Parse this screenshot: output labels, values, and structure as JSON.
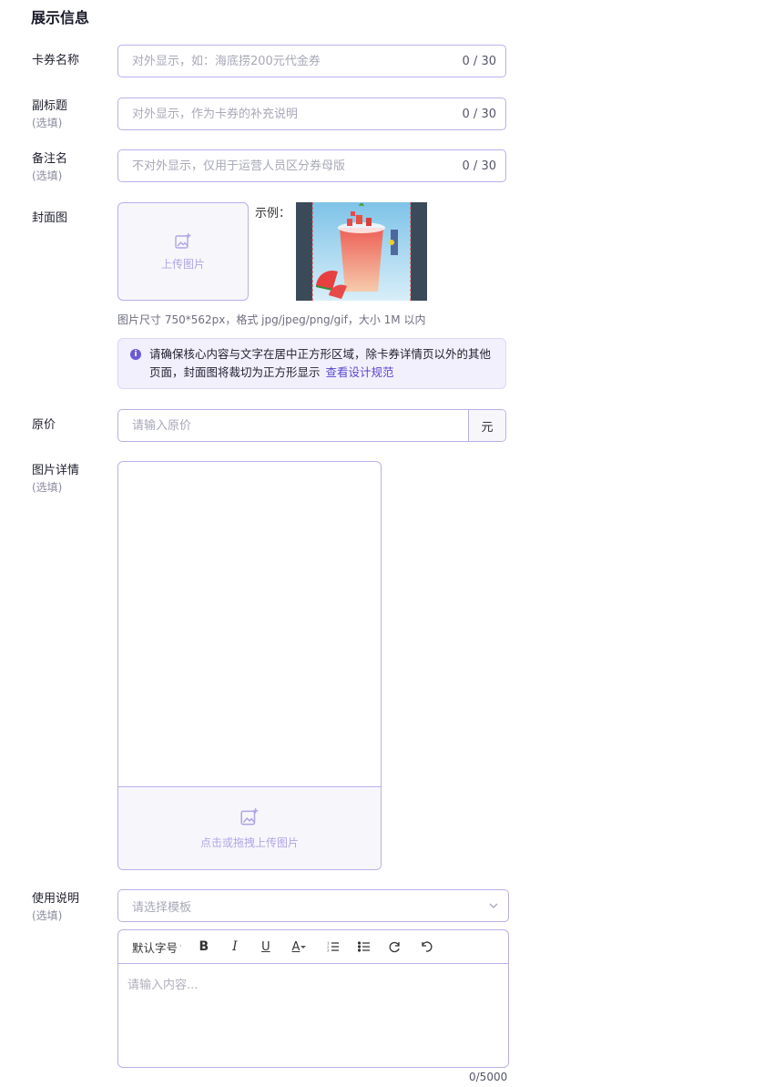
{
  "section_title": "展示信息",
  "optional_text": "(选填)",
  "fields": {
    "name": {
      "label": "卡券名称",
      "placeholder": "对外显示，如：海底捞200元代金券",
      "counter": "0 / 30"
    },
    "subtitle": {
      "label": "副标题",
      "placeholder": "对外显示，作为卡券的补充说明",
      "counter": "0 / 30"
    },
    "remark": {
      "label": "备注名",
      "placeholder": "不对外显示，仅用于运营人员区分券母版",
      "counter": "0 / 30"
    }
  },
  "cover": {
    "label": "封面图",
    "upload_label": "上传图片",
    "example_label": "示例：",
    "hint": "图片尺寸 750*562px，格式 jpg/jpeg/png/gif，大小 1M 以内",
    "notice_text": "请确保核心内容与文字在居中正方形区域，除卡券详情页以外的其他页面，封面图将裁切为正方形显示",
    "notice_link": "查看设计规范"
  },
  "price": {
    "label": "原价",
    "placeholder": "请输入原价",
    "unit": "元"
  },
  "details": {
    "label": "图片详情",
    "upload_label": "点击或拖拽上传图片"
  },
  "usage": {
    "label": "使用说明",
    "select_placeholder": "请选择模板",
    "toolbar": {
      "font_size": "默认字号",
      "bold": "B",
      "italic": "I",
      "underline": "U",
      "font_color": "A"
    },
    "content_placeholder": "请输入内容...",
    "word_count": "0/5000"
  },
  "colors": {
    "accent": "#6c5bd4",
    "border": "#b8b0ea",
    "link": "#5a48d0"
  }
}
